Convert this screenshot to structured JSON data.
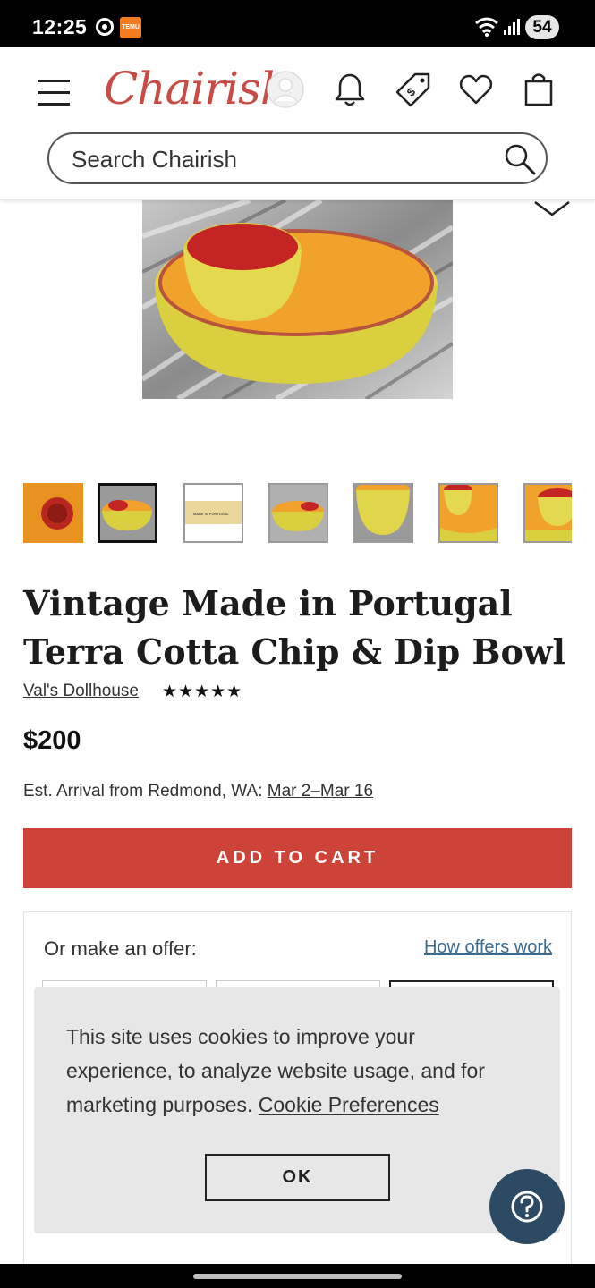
{
  "status_bar": {
    "time": "12:25",
    "battery": "54",
    "app_badge": "TEMU"
  },
  "header": {
    "logo": "Chairish",
    "search_placeholder": "Search Chairish",
    "icons": [
      "menu-icon",
      "account-icon",
      "bell-icon",
      "price-tag-icon",
      "heart-icon",
      "shopping-bag-icon",
      "search-icon"
    ]
  },
  "product": {
    "title": "Vintage Made in Portugal Terra Cotta Chip & Dip Bowl",
    "seller": "Val's Dollhouse",
    "rating": "★★★★★",
    "price": "$200",
    "arrival_prefix": "Est. Arrival from Redmond, WA: ",
    "arrival_dates": "Mar 2–Mar 16",
    "thumbnail_label": "MADE IN PORTUGAL"
  },
  "actions": {
    "add_to_cart": "ADD TO CART"
  },
  "offer": {
    "label": "Or make an offer:",
    "how_link": "How offers work"
  },
  "cookie_banner": {
    "text": "This site uses cookies to improve your experience, to analyze website usage, and for marketing purposes.",
    "link": "Cookie Preferences",
    "ok": "OK"
  },
  "colors": {
    "brand": "#c94b45",
    "cta": "#cd4338",
    "help_button": "#2c4a64",
    "link": "#3b6c8f"
  }
}
